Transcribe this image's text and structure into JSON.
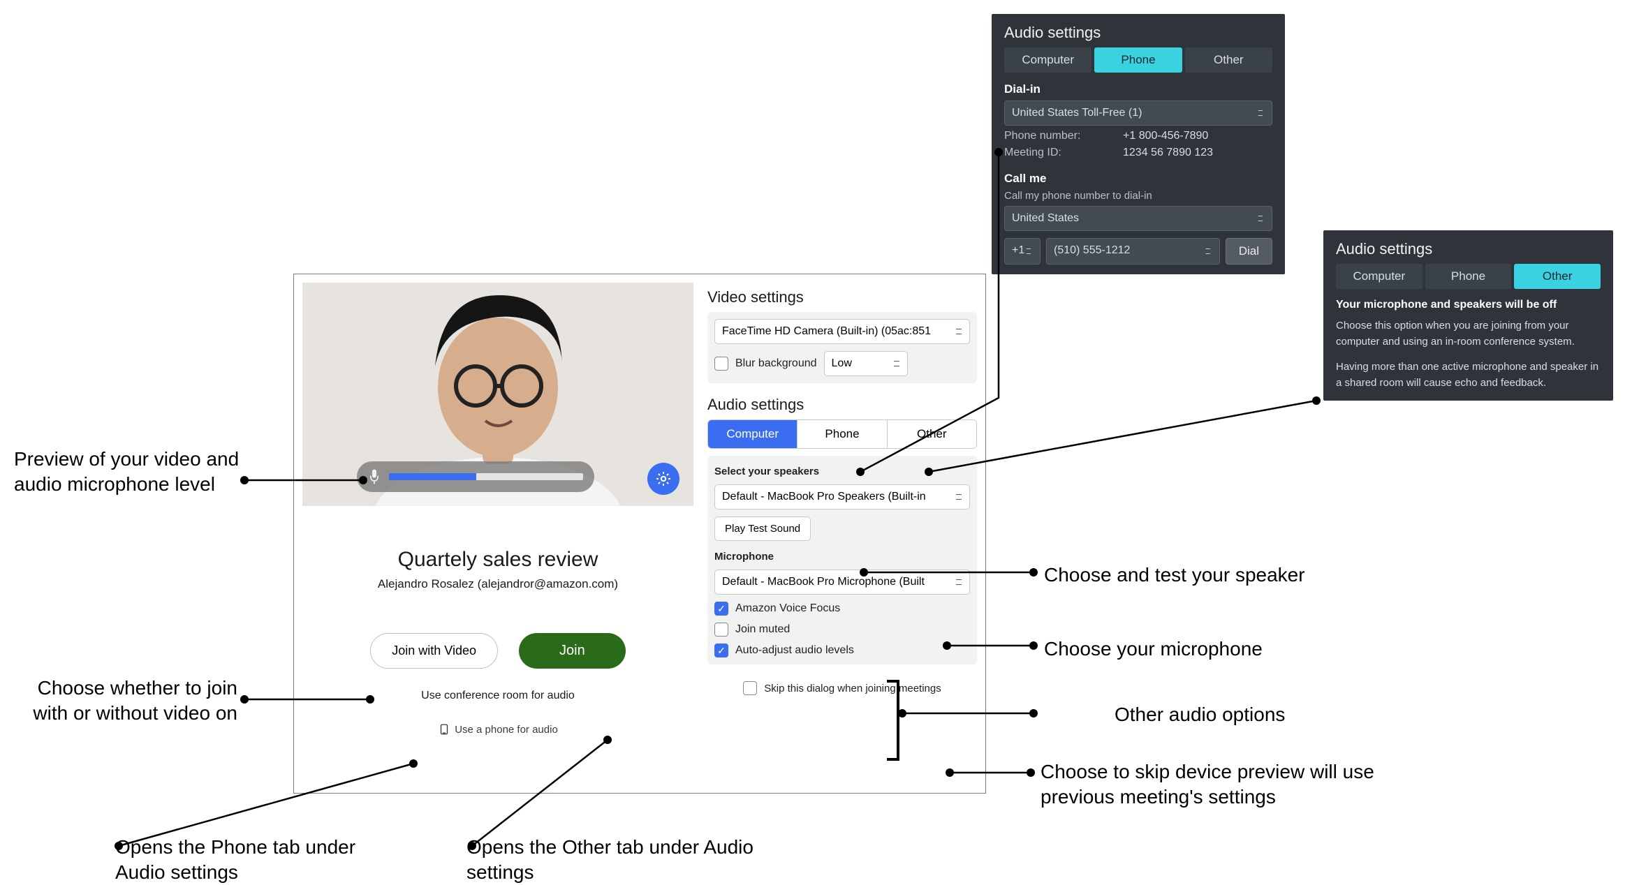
{
  "dialog": {
    "mic_level_pct": 45,
    "meeting_title": "Quartely sales review",
    "meeting_subtitle": "Alejandro Rosalez (alejandror@amazon.com)",
    "join_with_video_label": "Join with Video",
    "join_label": "Join",
    "conf_room_link": "Use conference room for audio",
    "phone_link": "Use a phone for audio",
    "video": {
      "title": "Video settings",
      "camera": "FaceTime HD Camera (Built-in) (05ac:851",
      "blur_label": "Blur background",
      "blur_checked": false,
      "blur_level": "Low"
    },
    "audio": {
      "title": "Audio settings",
      "tab_computer": "Computer",
      "tab_phone": "Phone",
      "tab_other": "Other",
      "speakers_label": "Select your speakers",
      "speakers_device": "Default - MacBook Pro Speakers (Built-in",
      "play_test": "Play Test Sound",
      "mic_label": "Microphone",
      "mic_device": "Default - MacBook Pro Microphone (Built",
      "opt_focus": "Amazon Voice Focus",
      "opt_muted": "Join muted",
      "opt_auto": "Auto-adjust audio levels",
      "opt_focus_checked": true,
      "opt_muted_checked": false,
      "opt_auto_checked": true
    },
    "skip_label": "Skip this dialog when joining meetings"
  },
  "phone_panel": {
    "title": "Audio settings",
    "tab_computer": "Computer",
    "tab_phone": "Phone",
    "tab_other": "Other",
    "dialin_label": "Dial-in",
    "dialin_region": "United States Toll-Free (1)",
    "phone_number_label": "Phone number:",
    "phone_number": "+1 800-456-7890",
    "meeting_id_label": "Meeting ID:",
    "meeting_id": "1234 56 7890 123",
    "callme_label": "Call me",
    "callme_sub": "Call my phone number to dial-in",
    "callme_region": "United States",
    "callme_cc": "+1",
    "callme_number": "(510) 555-1212",
    "dial_btn": "Dial"
  },
  "other_panel": {
    "title": "Audio settings",
    "tab_computer": "Computer",
    "tab_phone": "Phone",
    "tab_other": "Other",
    "headline": "Your microphone and speakers will be off",
    "p1": "Choose this option when you are joining from your computer and using an in-room conference system.",
    "p2": "Having more than one active microphone and speaker in a shared room will cause echo and feedback."
  },
  "captions": {
    "preview": "Preview of your video and audio microphone level",
    "speaker": "Choose and test your speaker",
    "mic": "Choose your microphone",
    "otheraudio": "Other audio options",
    "joinchoice": "Choose whether to join with or without video on",
    "skip": "Choose to skip device preview will use previous meeting's settings",
    "openphone": "Opens the Phone tab under Audio settings",
    "openother": "Opens the Other tab under Audio settings"
  }
}
